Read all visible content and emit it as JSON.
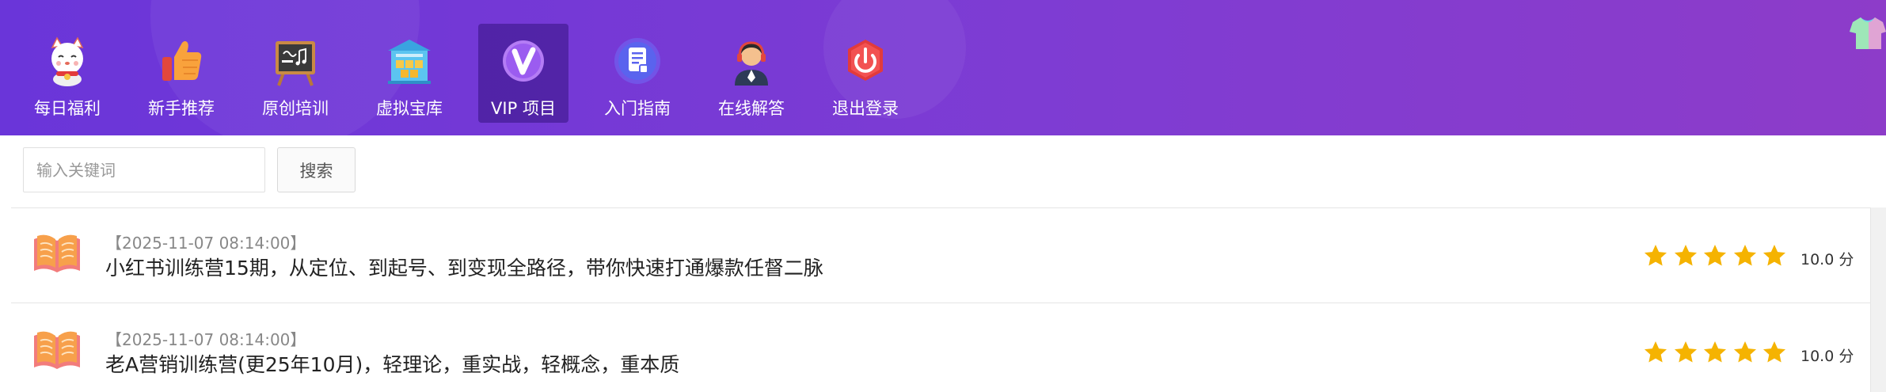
{
  "nav": {
    "items": [
      {
        "label": "每日福利",
        "icon": "lucky-cat-icon"
      },
      {
        "label": "新手推荐",
        "icon": "thumbs-up-icon"
      },
      {
        "label": "原创培训",
        "icon": "chalkboard-icon"
      },
      {
        "label": "虚拟宝库",
        "icon": "treasure-vault-icon"
      },
      {
        "label": "VIP 项目",
        "icon": "vip-badge-icon",
        "active": true
      },
      {
        "label": "入门指南",
        "icon": "document-guide-icon"
      },
      {
        "label": "在线解答",
        "icon": "support-agent-icon"
      },
      {
        "label": "退出登录",
        "icon": "power-off-icon"
      }
    ]
  },
  "header_right_icon": "t-shirt-skin-icon",
  "search": {
    "placeholder": "输入关键词",
    "button_label": "搜索"
  },
  "list": {
    "items": [
      {
        "date": "【2025-11-07 08:14:00】",
        "title": "小红书训练营15期，从定位、到起号、到变现全路径，带你快速打通爆款任督二脉",
        "rating": 5,
        "rating_max": 5,
        "score": "10.0 分",
        "icon": "open-book-icon"
      },
      {
        "date": "【2025-11-07 08:14:00】",
        "title": "老A营销训练营(更25年10月)，轻理论，重实战，轻概念，重本质",
        "rating": 5,
        "rating_max": 5,
        "score": "10.0 分",
        "icon": "open-book-icon"
      }
    ]
  },
  "colors": {
    "header_gradient_start": "#6a35d9",
    "header_gradient_end": "#8d3cc9",
    "nav_active_bg": "#4a1f9a",
    "star": "#f5b301",
    "book_orange": "#f7a04b",
    "book_pink": "#f27c7c"
  }
}
